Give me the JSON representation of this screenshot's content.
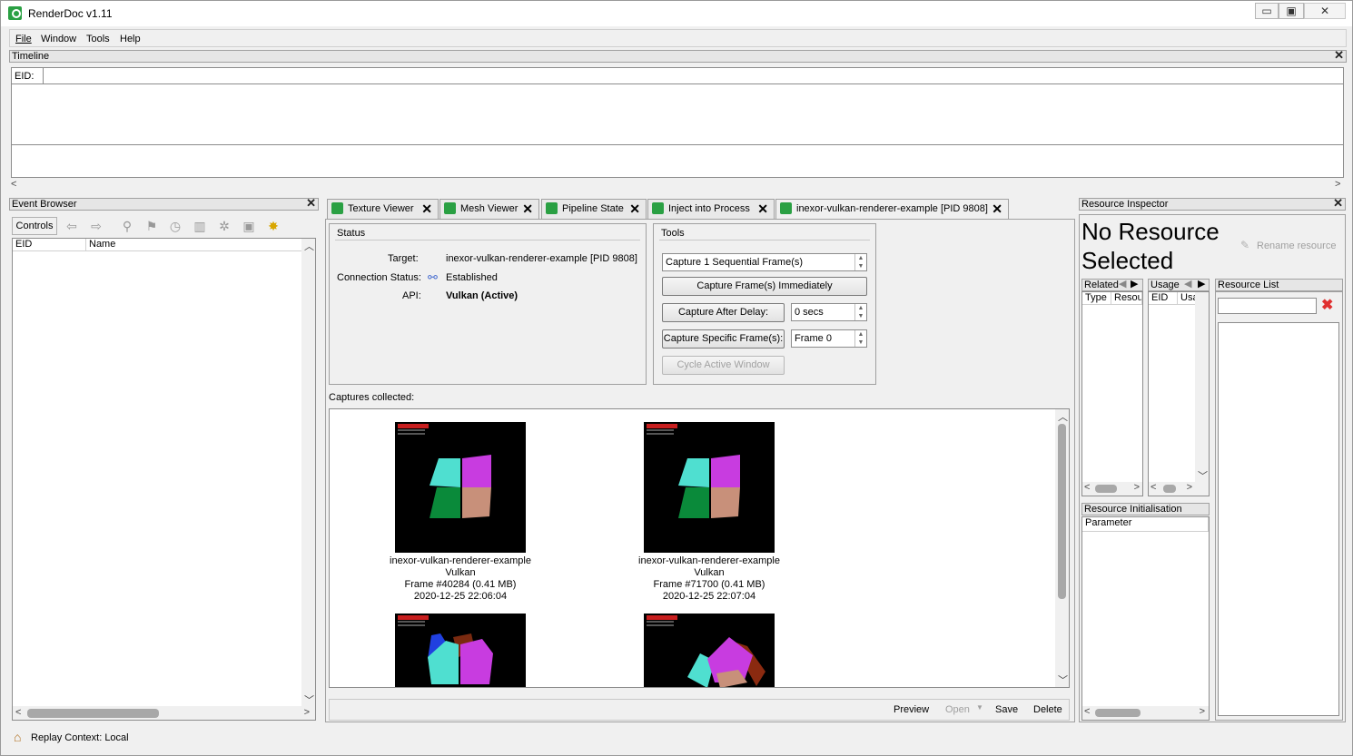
{
  "window": {
    "title": "RenderDoc v1.11",
    "min": "▭",
    "max": "▣",
    "close": "✕"
  },
  "menu": [
    "File",
    "Window",
    "Tools",
    "Help"
  ],
  "timeline": {
    "title": "Timeline",
    "eid_label": "EID:"
  },
  "event_browser": {
    "title": "Event Browser",
    "controls": "Controls",
    "columns": [
      "EID",
      "Name"
    ]
  },
  "tabs": [
    "Texture Viewer",
    "Mesh Viewer",
    "Pipeline State",
    "Inject into Process",
    "inexor-vulkan-renderer-example [PID 9808]"
  ],
  "status": {
    "title": "Status",
    "target_label": "Target:",
    "target": "inexor-vulkan-renderer-example [PID 9808]",
    "conn_label": "Connection Status:",
    "conn": "Established",
    "api_label": "API:",
    "api": "Vulkan (Active)"
  },
  "tools": {
    "title": "Tools",
    "capture_seq": "Capture 1 Sequential Frame(s)",
    "capture_now": "Capture Frame(s) Immediately",
    "capture_delay": "Capture After Delay:",
    "delay_value": "0 secs",
    "capture_specific": "Capture Specific Frame(s):",
    "frame_value": "Frame 0",
    "cycle": "Cycle Active Window"
  },
  "captures": {
    "label": "Captures collected:",
    "items": [
      {
        "name": "inexor-vulkan-renderer-example",
        "api": "Vulkan",
        "frame": "Frame #40284 (0.41 MB)",
        "time": "2020-12-25 22:06:04"
      },
      {
        "name": "inexor-vulkan-renderer-example",
        "api": "Vulkan",
        "frame": "Frame #71700 (0.41 MB)",
        "time": "2020-12-25 22:07:04"
      }
    ]
  },
  "bottom_buttons": {
    "preview": "Preview",
    "open": "Open",
    "save": "Save",
    "delete": "Delete"
  },
  "resource_inspector": {
    "title": "Resource Inspector",
    "no_resource": "No Resource Selected",
    "rename": "Rename resource",
    "related": "Related",
    "usage": "Usage",
    "resource_list": "Resource List",
    "type_col": "Type",
    "resource_col": "Resou",
    "eid_col": "EID",
    "usage_col": "Usa",
    "init_params": "Resource Initialisation Param",
    "parameter": "Parameter"
  },
  "statusbar": {
    "text": "Replay Context: Local"
  },
  "colors": {
    "accent": "#2aa043",
    "shape_cyan": "#4fdfd0",
    "shape_magenta": "#c83ce0",
    "shape_green": "#0a8a3a",
    "shape_tan": "#c8907a"
  }
}
